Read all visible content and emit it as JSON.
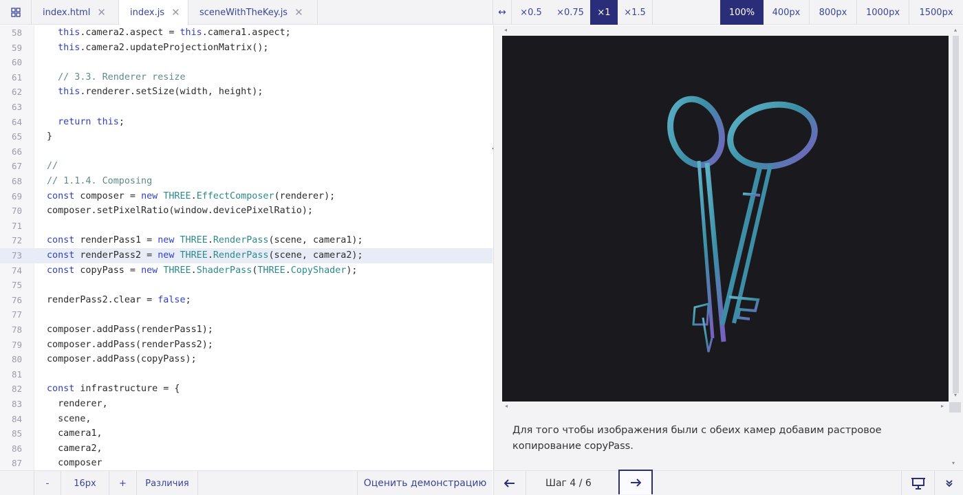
{
  "tabs": [
    {
      "label": "index.html"
    },
    {
      "label": "index.js"
    },
    {
      "label": "sceneWithTheKey.js"
    }
  ],
  "toolbar": {
    "resize_icon": "double-arrow-icon",
    "scales": [
      "×0.5",
      "×0.75",
      "×1",
      "×1.5"
    ],
    "active_scale": "×1",
    "widths": [
      "100%",
      "400px",
      "800px",
      "1000px",
      "1500px"
    ],
    "active_width": "100%"
  },
  "editor": {
    "lines": [
      {
        "n": "58",
        "code": "  this.camera2.aspect = this.camera1.aspect;"
      },
      {
        "n": "59",
        "code": "  this.camera2.updateProjectionMatrix();"
      },
      {
        "n": "60",
        "code": ""
      },
      {
        "n": "61",
        "code": "  // 3.3. Renderer resize"
      },
      {
        "n": "62",
        "code": "  this.renderer.setSize(width, height);"
      },
      {
        "n": "63",
        "code": ""
      },
      {
        "n": "64",
        "code": "  return this;"
      },
      {
        "n": "65",
        "code": "}"
      },
      {
        "n": "66",
        "code": ""
      },
      {
        "n": "67",
        "code": "//"
      },
      {
        "n": "68",
        "code": "// 1.1.4. Composing"
      },
      {
        "n": "69",
        "code": "const composer = new THREE.EffectComposer(renderer);"
      },
      {
        "n": "70",
        "code": "composer.setPixelRatio(window.devicePixelRatio);"
      },
      {
        "n": "71",
        "code": ""
      },
      {
        "n": "72",
        "code": "const renderPass1 = new THREE.RenderPass(scene, camera1);"
      },
      {
        "n": "73",
        "code": "const renderPass2 = new THREE.RenderPass(scene, camera2);"
      },
      {
        "n": "74",
        "code": "const copyPass = new THREE.ShaderPass(THREE.CopyShader);"
      },
      {
        "n": "75",
        "code": ""
      },
      {
        "n": "76",
        "code": "renderPass2.clear = false;"
      },
      {
        "n": "77",
        "code": ""
      },
      {
        "n": "78",
        "code": "composer.addPass(renderPass1);"
      },
      {
        "n": "79",
        "code": "composer.addPass(renderPass2);"
      },
      {
        "n": "80",
        "code": "composer.addPass(copyPass);"
      },
      {
        "n": "81",
        "code": ""
      },
      {
        "n": "82",
        "code": "const infrastructure = {"
      },
      {
        "n": "83",
        "code": "  renderer,"
      },
      {
        "n": "84",
        "code": "  scene,"
      },
      {
        "n": "85",
        "code": "  camera1,"
      },
      {
        "n": "86",
        "code": "  camera2,"
      },
      {
        "n": "87",
        "code": "  composer"
      }
    ],
    "current_line": "73"
  },
  "bottom_left": {
    "decrease": "-",
    "font_size": "16px",
    "increase": "+",
    "diff": "Различия",
    "rate": "Оценить демонстрацию"
  },
  "preview": {
    "description": "Для того чтобы изображения были с обеих камер добавим растровое копирование copyPass."
  },
  "bottom_right": {
    "prev_icon": "arrow-left-icon",
    "step": "Шаг 4 / 6",
    "next_icon": "arrow-right-icon",
    "present_icon": "presentation-icon",
    "expand_icon": "double-chevron-down-icon"
  },
  "colors": {
    "accent": "#2a2e78",
    "link": "#3b4596",
    "keyword": "#2f3fc9",
    "class": "#2a8b8b",
    "comment": "#5f8a8a",
    "canvas_bg": "#1a1a1e",
    "key_metal": "#4a9bb0"
  }
}
